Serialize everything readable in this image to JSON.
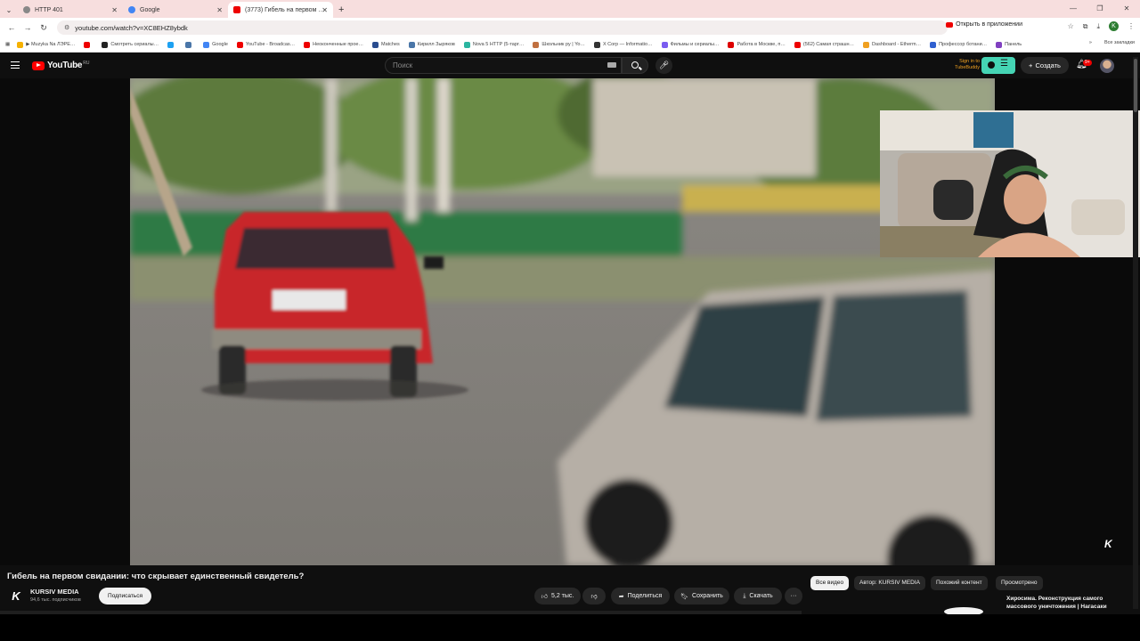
{
  "browser": {
    "tabs": [
      {
        "label": "HTTP 401",
        "active": false
      },
      {
        "label": "Google",
        "active": false
      },
      {
        "label": "(3773) Гибель на первом …",
        "active": true
      }
    ],
    "new_tab": "+",
    "url": "youtube.com/watch?v=XC8EHZ8ybdk",
    "open_in_app": "Открыть в приложении",
    "bookmarks": [
      "▶ Muzyka Na ЛЭРЕ…",
      "Смотреть сериалы…",
      "Google",
      "YouTube - Broadcas…",
      "Неоконченные прое…",
      "Matches",
      "Кирилл Зыряков",
      "Nova 5 HTTP (5-тарг…",
      "Школьник ру | Yo…",
      "X Corp — Informatio…",
      "Фильмы и сериалы…",
      "Работа в Москве, п…",
      "(562) Самая страшн…",
      "Dashboard - Etherm…",
      "Профессор ботани…",
      "Панель"
    ],
    "all_bookmarks": "Все закладки"
  },
  "youtube": {
    "logo": "YouTube",
    "country": "RU",
    "search_placeholder": "Поиск",
    "tubebuddy": "Sign in to TubeBuddy",
    "create": "Создать",
    "notif_count": "9+"
  },
  "video": {
    "title": "Гибель на первом свидании: что скрывает единственный свидетель?",
    "channel_name": "KURSIV MEDIA",
    "channel_logo": "K",
    "subscribers": "94,6 тыс. подписчиков",
    "subscribe": "Подписаться",
    "likes": "5,2 тыс.",
    "share": "Поделиться",
    "save": "Сохранить",
    "download": "Скачать",
    "more": "···",
    "watermark": "K"
  },
  "filters": [
    "Все видео",
    "Автор: KURSIV MEDIA",
    "Похожий контент",
    "Просмотрено"
  ],
  "recommendation": {
    "title": "Хиросима. Реконструкция самого массового уничтожения | Нагасаки"
  },
  "colors": {
    "accent": "#ff0000",
    "tubebuddy": "#45d4b4"
  }
}
